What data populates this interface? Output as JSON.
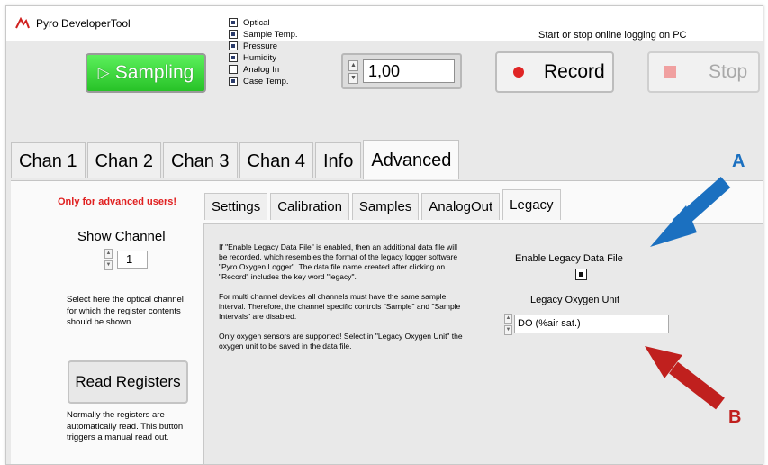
{
  "window": {
    "title": "Pyro DeveloperTool"
  },
  "top": {
    "sampling_label": "Sampling",
    "sensors": [
      {
        "label": "Optical",
        "checked": true
      },
      {
        "label": "Sample Temp.",
        "checked": true
      },
      {
        "label": "Pressure",
        "checked": true
      },
      {
        "label": "Humidity",
        "checked": true
      },
      {
        "label": "Analog In",
        "checked": false
      },
      {
        "label": "Case Temp.",
        "checked": true
      }
    ],
    "interval_value": "1,00",
    "logging_hint": "Start or stop online logging on PC",
    "record_label": "Record",
    "stop_label": "Stop"
  },
  "main_tabs": [
    "Chan 1",
    "Chan 2",
    "Chan 3",
    "Chan 4",
    "Info",
    "Advanced"
  ],
  "main_tab_active": "Advanced",
  "advanced": {
    "warning": "Only for advanced users!",
    "show_channel_label": "Show Channel",
    "show_channel_value": "1",
    "show_channel_help": "Select here the optical channel for which the register contents should be shown.",
    "read_registers_label": "Read Registers",
    "read_registers_help": "Normally the registers are automatically read. This button triggers a manual read out.",
    "sub_tabs": [
      "Settings",
      "Calibration",
      "Samples",
      "AnalogOut",
      "Legacy"
    ],
    "sub_tab_active": "Legacy",
    "legacy": {
      "paragraph1": "If \"Enable Legacy Data File\" is enabled, then an additional data file will be recorded, which resembles the format of the legacy logger software \"Pyro Oxygen Logger\". The data file name created after clicking on \"Record\" includes the key word \"legacy\".",
      "paragraph2": "For multi channel devices all channels must have the same sample interval. Therefore, the channel specific controls \"Sample\" and \"Sample Intervals\" are disabled.",
      "paragraph3": "Only oxygen sensors are supported! Select in \"Legacy Oxygen Unit\" the oxygen unit to be saved in the data file.",
      "enable_label": "Enable Legacy Data File",
      "enable_checked": true,
      "unit_label": "Legacy Oxygen Unit",
      "unit_value": "DO (%air sat.)"
    }
  },
  "annotations": {
    "a": "A",
    "b": "B",
    "a_color": "#1b70c0",
    "b_color": "#c0201e"
  },
  "colors": {
    "sampling_green": "#2ec42e",
    "record_red": "#e02525",
    "warning_red": "#e02020"
  }
}
